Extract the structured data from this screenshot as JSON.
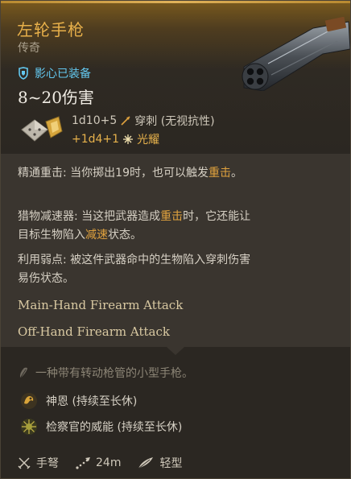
{
  "item": {
    "name": "左轮手枪",
    "rarity": "传奇",
    "equipped_by": "影心已装备",
    "damage_range": "8~20伤害",
    "damage_line1_dice": "1d10+5",
    "damage_line1_type": "穿刺 (无视抗性)",
    "damage_line2_dice": "+1d4+1",
    "damage_line2_type": "光耀"
  },
  "passives": [
    {
      "label": "精通重击:",
      "pre": " 当你掷出19时，也可以触发",
      "hl": "重击",
      "post": "。"
    },
    {
      "label": "猎物减速器:",
      "pre": " 当这把武器造成",
      "hl": "重击",
      "mid": "时，它还能让目标生物陷入",
      "hl2": "减速",
      "post": "状态。"
    },
    {
      "label": "利用弱点:",
      "pre": " 被这件武器命中的生物陷入穿刺伤害易伤状态。"
    }
  ],
  "attacks": [
    "Main-Hand Firearm Attack",
    "Off-Hand Firearm Attack"
  ],
  "flavor_text": "一种带有转动枪管的小型手枪。",
  "effects": [
    {
      "label": "神恩 (持续至长休)",
      "icon": "divine-favour-icon"
    },
    {
      "label": "检察官的威能 (持续至长休)",
      "icon": "inquisitor-might-icon"
    }
  ],
  "footer": {
    "proficiency": "手弩",
    "range": "24m",
    "weight": "轻型"
  },
  "colors": {
    "title": "#e8b04a",
    "equipped": "#63c8ef",
    "highlight": "#e0a23e",
    "radiant": "#e7b24c"
  }
}
